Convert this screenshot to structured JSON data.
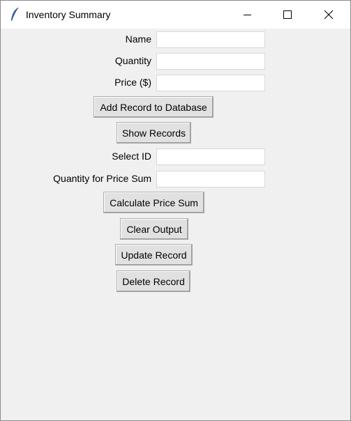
{
  "window": {
    "title": "Inventory Summary"
  },
  "form": {
    "name_label": "Name",
    "quantity_label": "Quantity",
    "price_label": "Price ($)",
    "select_id_label": "Select ID",
    "qty_price_sum_label": "Quantity for Price Sum",
    "name_value": "",
    "quantity_value": "",
    "price_value": "",
    "select_id_value": "",
    "qty_price_sum_value": ""
  },
  "buttons": {
    "add": "Add Record to Database",
    "show": "Show Records",
    "calc": "Calculate Price Sum",
    "clear": "Clear Output",
    "update": "Update Record",
    "delete": "Delete Record"
  }
}
